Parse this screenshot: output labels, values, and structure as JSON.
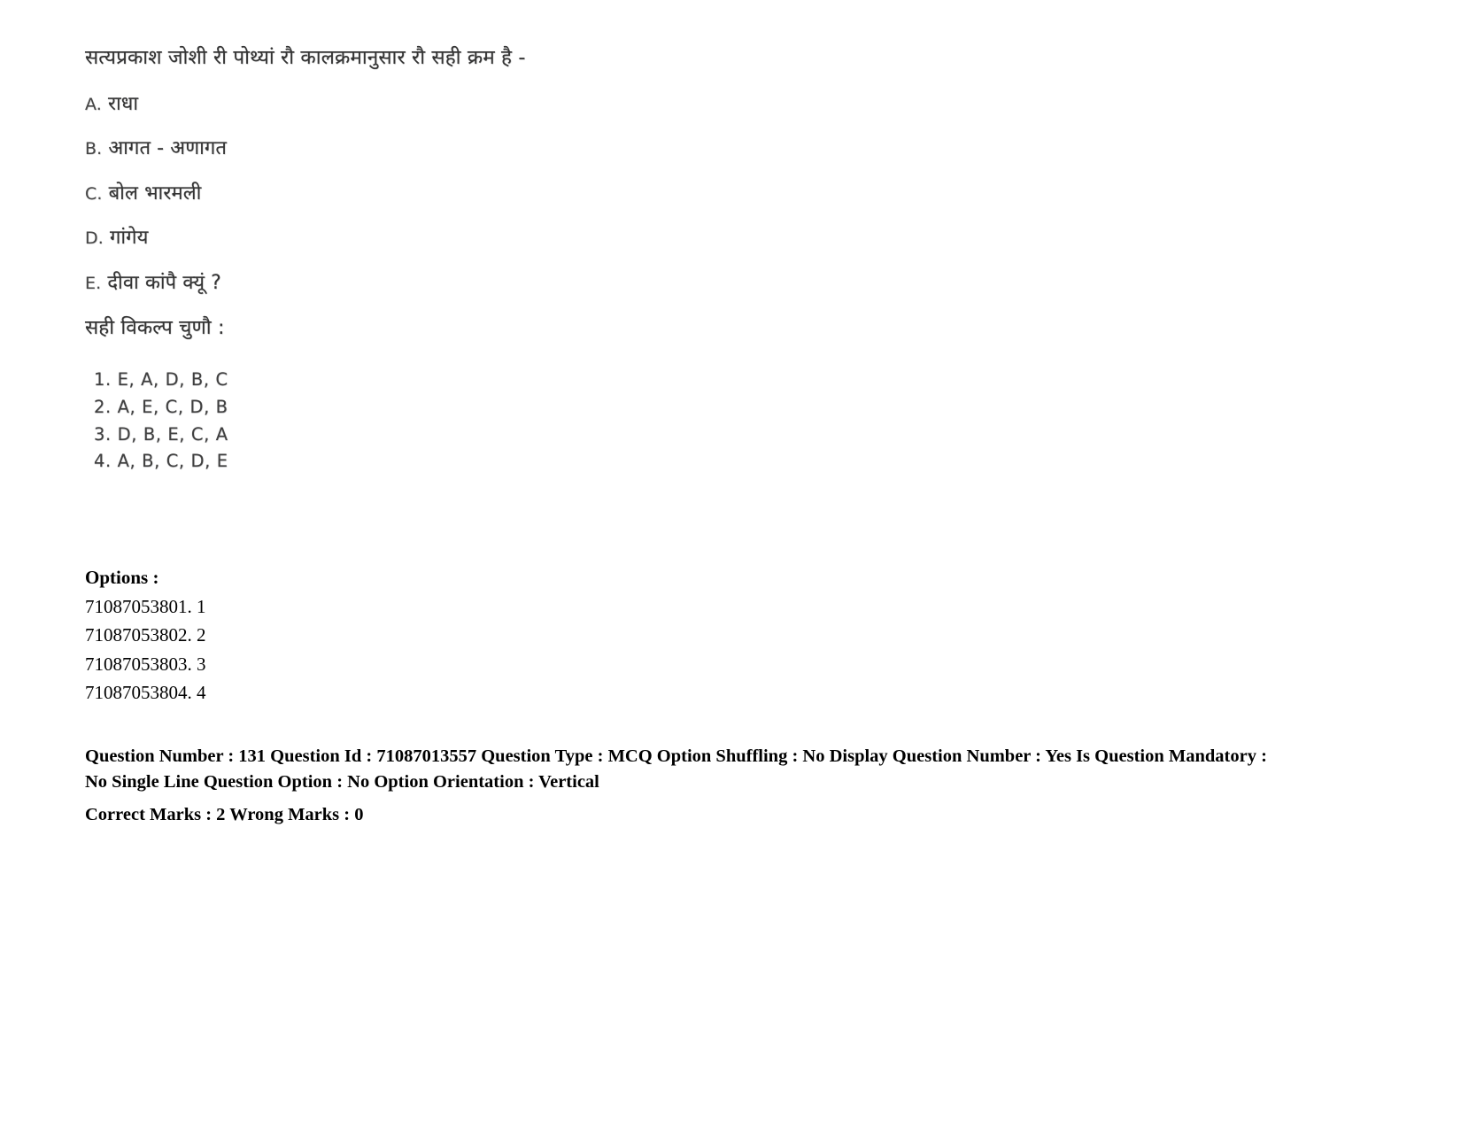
{
  "question": {
    "stem": "सत्यप्रकाश जोशी री पोथ्यां रौ कालक्रमानुसार रौ सही क्रम है -",
    "items": [
      {
        "letter": "A.",
        "text": "राधा"
      },
      {
        "letter": "B.",
        "text": "आगत - अणागत"
      },
      {
        "letter": "C.",
        "text": "बोल भारमली"
      },
      {
        "letter": "D.",
        "text": "गांगेय"
      },
      {
        "letter": "E.",
        "text": "दीवा कांपै क्यूं ?"
      }
    ],
    "instruction": "सही विकल्प चुणौ :",
    "choices": [
      "1. E, A, D, B, C",
      "2. A, E, C, D, B",
      "3. D, B, E, C, A",
      "4. A, B, C, D, E"
    ]
  },
  "options": {
    "title": "Options :",
    "rows": [
      "71087053801. 1",
      "71087053802. 2",
      "71087053803. 3",
      "71087053804. 4"
    ]
  },
  "meta": {
    "line1": "Question Number : 131 Question Id : 71087013557 Question Type : MCQ Option Shuffling : No Display Question Number : Yes Is Question Mandatory : No Single Line Question Option : No Option Orientation : Vertical",
    "line2": "Correct Marks : 2 Wrong Marks : 0"
  }
}
